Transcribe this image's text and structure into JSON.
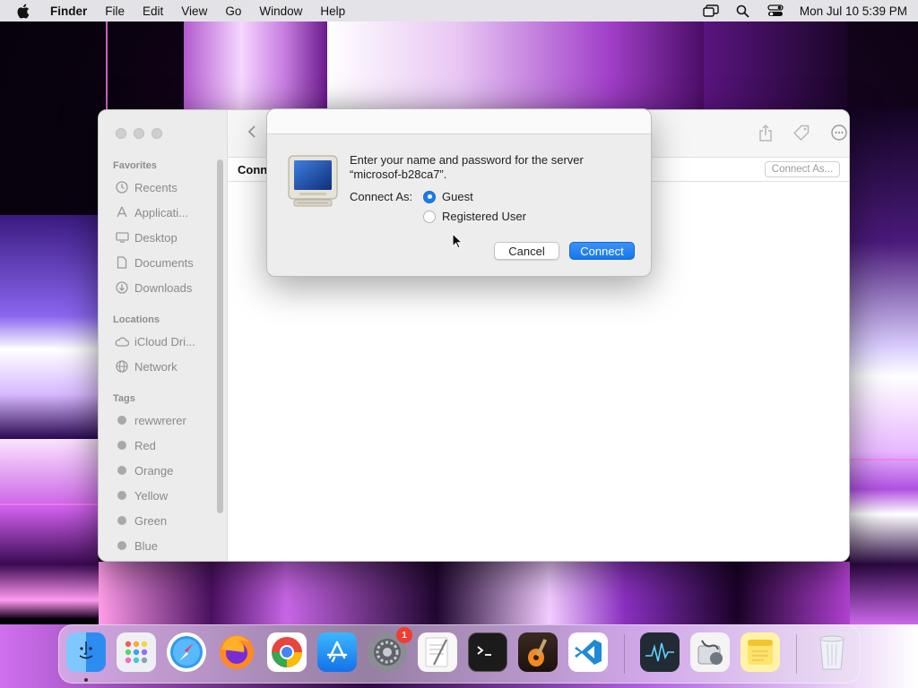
{
  "menubar": {
    "app_name": "Finder",
    "menus": [
      "File",
      "Edit",
      "View",
      "Go",
      "Window",
      "Help"
    ],
    "clock": "Mon Jul 10  5:39 PM"
  },
  "finder": {
    "sidebar": {
      "favorites_header": "Favorites",
      "favorites": [
        "Recents",
        "Applicati...",
        "Desktop",
        "Documents",
        "Downloads"
      ],
      "locations_header": "Locations",
      "locations": [
        "iCloud Dri...",
        "Network"
      ],
      "tags_header": "Tags",
      "tags": [
        "rewwrerer",
        "Red",
        "Orange",
        "Yellow",
        "Green",
        "Blue"
      ]
    },
    "path_label": "Conn",
    "connect_as_button": "Connect As..."
  },
  "dialog": {
    "message_line1": "Enter your name and password for the server",
    "message_line2": "“microsof-b28ca7”.",
    "connect_as_label": "Connect As:",
    "options": [
      {
        "label": "Guest",
        "selected": true
      },
      {
        "label": "Registered User",
        "selected": false
      }
    ],
    "cancel_label": "Cancel",
    "connect_label": "Connect",
    "accent_color": "#1a7cf0"
  },
  "dock": {
    "apps": [
      "Finder",
      "Launchpad",
      "Safari",
      "Firefox",
      "Chrome",
      "App Store",
      "System Settings",
      "TextEdit",
      "Terminal",
      "GarageBand",
      "Visual Studio Code",
      "Activity Monitor",
      "Disk Utility",
      "Notes",
      "Trash"
    ],
    "system_settings_badge": "1"
  }
}
